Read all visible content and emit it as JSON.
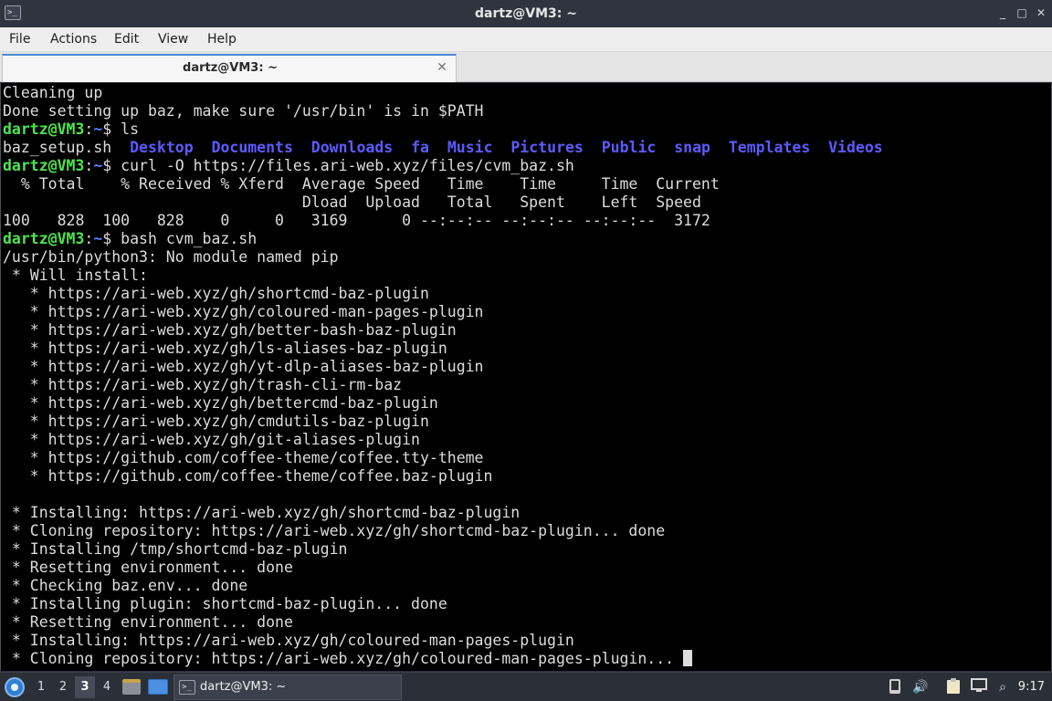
{
  "window": {
    "title": "dartz@VM3: ~",
    "app_icon": "terminal-icon",
    "minimize_glyph": "_",
    "maximize_glyph": "□",
    "close_glyph": "✕"
  },
  "menu": [
    "File",
    "Actions",
    "Edit",
    "View",
    "Help"
  ],
  "tab": {
    "label": "dartz@VM3: ~",
    "close_glyph": "✕"
  },
  "prompt": {
    "user": "dartz@VM3",
    "sep": ":",
    "path": "~",
    "sym": "$ "
  },
  "terminal": {
    "l0": "Cleaning up",
    "l1": "Done setting up baz, make sure '/usr/bin' is in $PATH",
    "cmd_ls": "ls",
    "ls_file": "baz_setup.sh",
    "ls_dirs": [
      "Desktop",
      "Documents",
      "Downloads",
      "fa",
      "Music",
      "Pictures",
      "Public",
      "snap",
      "Templates",
      "Videos"
    ],
    "cmd_curl": "curl -O https://files.ari-web.xyz/files/cvm_baz.sh",
    "curl_h1": "  % Total    % Received % Xferd  Average Speed   Time    Time     Time  Current",
    "curl_h2": "                                 Dload  Upload   Total   Spent    Left  Speed",
    "curl_row": "100   828  100   828    0     0   3169      0 --:--:-- --:--:-- --:--:--  3172",
    "cmd_bash": "bash cvm_baz.sh",
    "l_pip": "/usr/bin/python3: No module named pip",
    "l_will": " * Will install:",
    "plugins": [
      "   * https://ari-web.xyz/gh/shortcmd-baz-plugin",
      "   * https://ari-web.xyz/gh/coloured-man-pages-plugin",
      "   * https://ari-web.xyz/gh/better-bash-baz-plugin",
      "   * https://ari-web.xyz/gh/ls-aliases-baz-plugin",
      "   * https://ari-web.xyz/gh/yt-dlp-aliases-baz-plugin",
      "   * https://ari-web.xyz/gh/trash-cli-rm-baz",
      "   * https://ari-web.xyz/gh/bettercmd-baz-plugin",
      "   * https://ari-web.xyz/gh/cmdutils-baz-plugin",
      "   * https://ari-web.xyz/gh/git-aliases-plugin",
      "   * https://github.com/coffee-theme/coffee.tty-theme",
      "   * https://github.com/coffee-theme/coffee.baz-plugin"
    ],
    "install_log": [
      " * Installing: https://ari-web.xyz/gh/shortcmd-baz-plugin",
      " * Cloning repository: https://ari-web.xyz/gh/shortcmd-baz-plugin... done",
      " * Installing /tmp/shortcmd-baz-plugin",
      " * Resetting environment... done",
      " * Checking baz.env... done",
      " * Installing plugin: shortcmd-baz-plugin... done",
      " * Resetting environment... done",
      " * Installing: https://ari-web.xyz/gh/coloured-man-pages-plugin"
    ],
    "last_line": " * Cloning repository: https://ari-web.xyz/gh/coloured-man-pages-plugin... "
  },
  "taskbar": {
    "start_icon": "xubuntu-start-icon",
    "workspaces": [
      "1",
      "2",
      "3",
      "4"
    ],
    "active_workspace": "3",
    "task_label": "dartz@VM3: ~",
    "tray": {
      "updates_icon": "update-phone-icon",
      "volume_icon": "speaker-icon",
      "clipboard_icon": "clipboard-icon",
      "network_icon": "network-icon",
      "search_icon": "search-icon",
      "volume_glyph": "🔊",
      "search_glyph": "⌕"
    },
    "clock": "9:17"
  }
}
